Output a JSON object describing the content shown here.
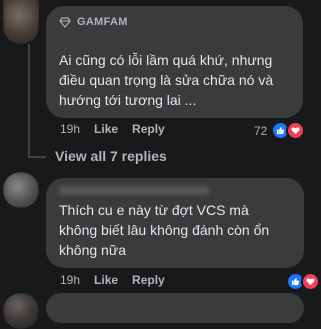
{
  "comments": [
    {
      "badge": "GAMFAM",
      "text_lines": [
        "Ai cũng có lỗi lầm quá khứ, nhưng",
        "điều quan trọng là sửa chữa nó và",
        "hướng tới tương lai ..."
      ],
      "time": "19h",
      "like_label": "Like",
      "reply_label": "Reply",
      "reaction_count": "72"
    },
    {
      "text_lines": [
        "Thích cu e này từ đợt VCS mà",
        "không biết lâu không đánh còn ổn",
        "không nữa"
      ],
      "time": "19h",
      "like_label": "Like",
      "reply_label": "Reply"
    }
  ],
  "view_replies": "View all 7 replies",
  "colors": {
    "like": "#1877f2",
    "love": "#f33e58",
    "bubble": "#3a3b3c",
    "background": "#18191a"
  }
}
